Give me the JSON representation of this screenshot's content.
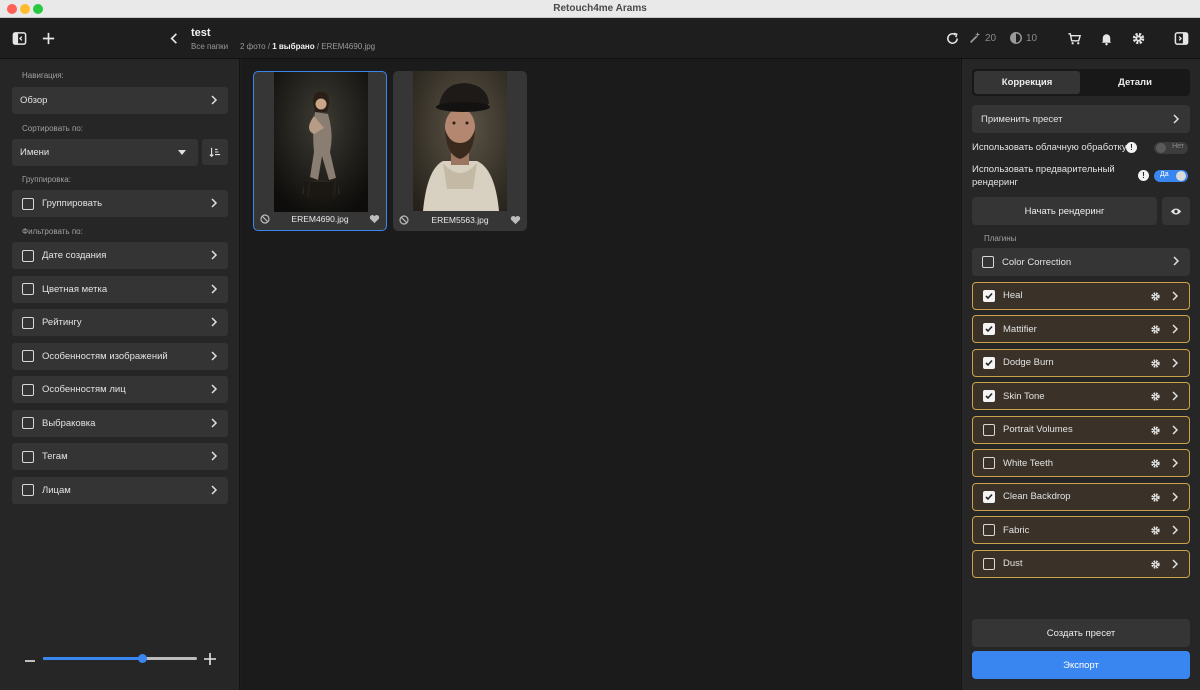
{
  "window": {
    "title": "Retouch4me Arams"
  },
  "toolbar": {
    "folder_title": "test",
    "folder_sub": "Все папки",
    "crumb_count": "2 фото / ",
    "crumb_selected": "1 выбрано",
    "crumb_file": " / EREM4690.jpg",
    "credits_a": "20",
    "credits_b": "10",
    "icons": [
      "sidebar-toggle-icon",
      "plus-icon",
      "back-chevron-icon",
      "refresh-icon",
      "magic-wand-icon",
      "face-credit-icon",
      "cart-icon",
      "bell-icon",
      "gear-icon",
      "panel-right-icon"
    ]
  },
  "sidebar": {
    "nav_label": "Навигация:",
    "overview": "Обзор",
    "sort_label": "Сортировать по:",
    "sort_value": "Имени",
    "group_label": "Группировка:",
    "group_item": "Группировать",
    "filter_label": "Фильтровать по:",
    "filters": [
      "Дате создания",
      "Цветная метка",
      "Рейтингу",
      "Особенностям изображений",
      "Особенностям лиц",
      "Выбраковка",
      "Тегам",
      "Лицам"
    ],
    "zoom_level": 0.64
  },
  "gallery": {
    "items": [
      {
        "name": "EREM4690.jpg",
        "selected": true
      },
      {
        "name": "EREM5563.jpg",
        "selected": false
      }
    ]
  },
  "right": {
    "tab_correction": "Коррекция",
    "tab_details": "Детали",
    "apply_preset": "Применить пресет",
    "cloud_label": "Использовать облачную обработку",
    "cloud_state": "Нет",
    "prerender_label_1": "Использовать предварительный",
    "prerender_label_2": "рендеринг",
    "prerender_state": "Да",
    "start_render": "Начать рендеринг",
    "plugins_label": "Плагины",
    "plugins": [
      {
        "name": "Color Correction",
        "checked": false,
        "plain": true
      },
      {
        "name": "Heal",
        "checked": true
      },
      {
        "name": "Mattifier",
        "checked": true
      },
      {
        "name": "Dodge Burn",
        "checked": true
      },
      {
        "name": "Skin Tone",
        "checked": true
      },
      {
        "name": "Portrait Volumes",
        "checked": false
      },
      {
        "name": "White Teeth",
        "checked": false
      },
      {
        "name": "Clean Backdrop",
        "checked": true
      },
      {
        "name": "Fabric",
        "checked": false
      },
      {
        "name": "Dust",
        "checked": false
      }
    ],
    "create_preset": "Создать пресет",
    "export": "Экспорт"
  },
  "colors": {
    "accent": "#3a86f0",
    "plugin_border": "#c9a24a"
  }
}
